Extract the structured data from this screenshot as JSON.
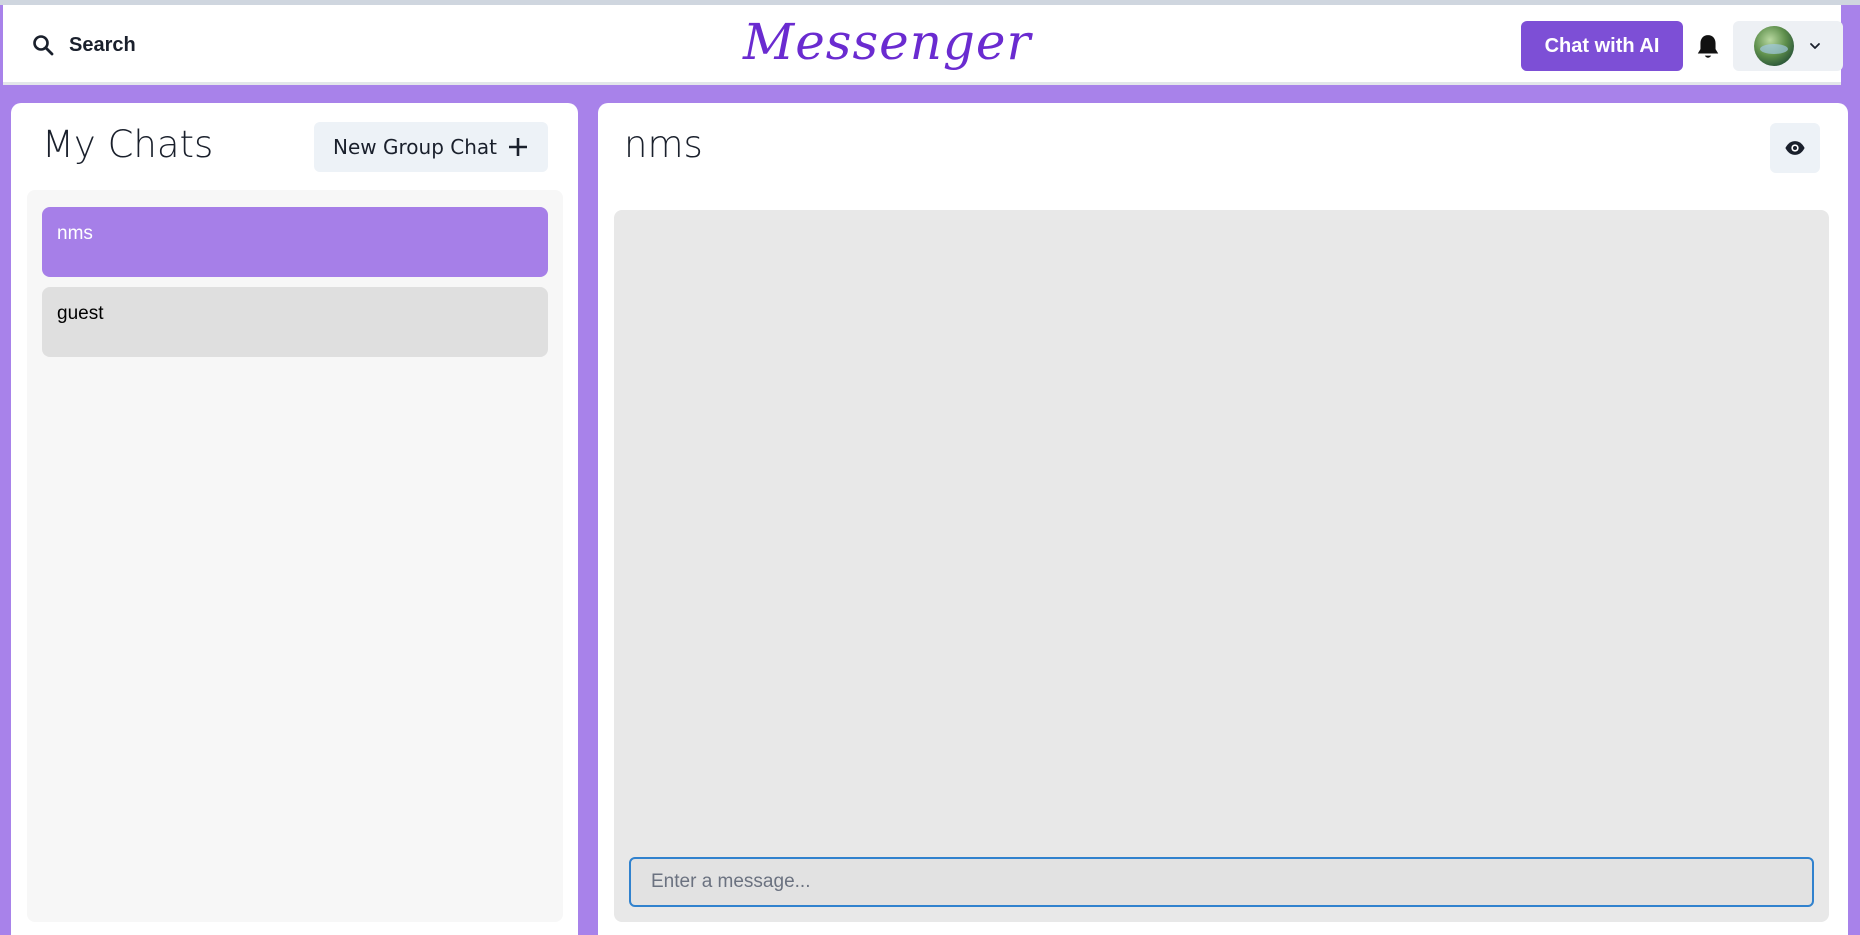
{
  "header": {
    "search_label": "Search",
    "brand": "Messenger",
    "ai_button_label": "Chat with AI",
    "colors": {
      "brand": "#6a2bd0",
      "ai_button": "#7d4fd6",
      "page_background": "#a882ea"
    }
  },
  "sidebar": {
    "title": "My Chats",
    "new_group_label": "New Group Chat",
    "chats": [
      {
        "name": "nms",
        "selected": true
      },
      {
        "name": "guest",
        "selected": false
      }
    ]
  },
  "chat": {
    "title": "nms",
    "input_placeholder": "Enter a message...",
    "input_value": ""
  },
  "icons": [
    "search-icon",
    "bell-icon",
    "avatar",
    "chevron-down-icon",
    "plus-icon",
    "eye-icon"
  ]
}
